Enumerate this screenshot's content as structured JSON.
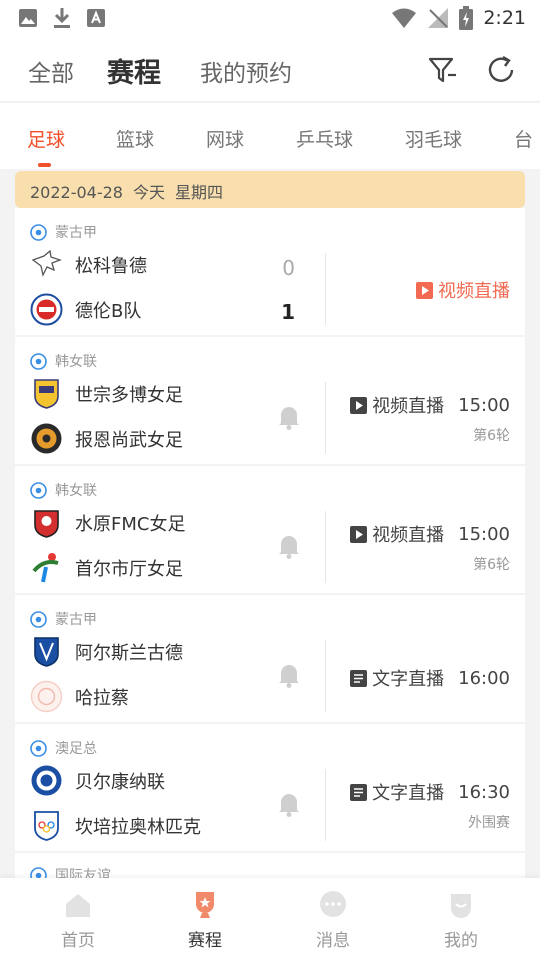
{
  "status_bar": {
    "time": "2:21"
  },
  "header": {
    "tabs": [
      {
        "label": "全部",
        "active": false
      },
      {
        "label": "赛程",
        "active": true
      },
      {
        "label": "我的预约",
        "active": false
      }
    ],
    "filter_icon": "filter-icon",
    "refresh_icon": "refresh-icon"
  },
  "sport_tabs": [
    "足球",
    "篮球",
    "网球",
    "乒乓球",
    "羽毛球",
    "台"
  ],
  "active_sport": "足球",
  "date_bar": {
    "date": "2022-04-28",
    "day": "今天",
    "weekday": "星期四"
  },
  "matches": [
    {
      "league": "蒙古甲",
      "home": "松科鲁德",
      "away": "德伦B队",
      "home_score": "0",
      "away_score": "1",
      "live": "视频直播",
      "time": "",
      "round": ""
    },
    {
      "league": "韩女联",
      "home": "世宗多博女足",
      "away": "报恩尚武女足",
      "live": "视频直播",
      "time": "15:00",
      "round": "第6轮"
    },
    {
      "league": "韩女联",
      "home": "水原FMC女足",
      "away": "首尔市厅女足",
      "live": "视频直播",
      "time": "15:00",
      "round": "第6轮"
    },
    {
      "league": "蒙古甲",
      "home": "阿尔斯兰古德",
      "away": "哈拉蔡",
      "live": "文字直播",
      "time": "16:00",
      "round": ""
    },
    {
      "league": "澳足总",
      "home": "贝尔康纳联",
      "away": "坎培拉奥林匹克",
      "live": "文字直播",
      "time": "16:30",
      "round": "外围赛"
    }
  ],
  "partial_league": "国际友谊",
  "bottom_nav": [
    {
      "label": "首页",
      "icon": "home-icon",
      "active": false
    },
    {
      "label": "赛程",
      "icon": "trophy-icon",
      "active": true
    },
    {
      "label": "消息",
      "icon": "chat-icon",
      "active": false
    },
    {
      "label": "我的",
      "icon": "profile-icon",
      "active": false
    }
  ],
  "colors": {
    "accent": "#f0502a",
    "date_bar_bg": "#f9dfae",
    "live_red": "#f26a52"
  }
}
